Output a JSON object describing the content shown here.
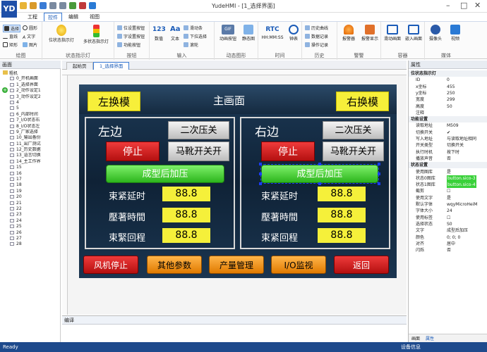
{
  "app": {
    "logo": "YD",
    "title": "YudeHMI - [1_选择界面]"
  },
  "menu": [
    "工程",
    "控件",
    "编辑",
    "视图"
  ],
  "ribbon": {
    "draw": {
      "caption": "绘图",
      "items": [
        "选择",
        "圆形",
        "直线",
        "文字",
        "矩形",
        "图片"
      ]
    },
    "indicator": {
      "caption": "状态指示灯",
      "items": [
        "位状态指示灯",
        "多状态指示灯"
      ]
    },
    "button": {
      "caption": "按钮",
      "items": [
        "位设置按钮",
        "字设置按钮",
        "功能按钮"
      ]
    },
    "input": {
      "caption": "输入",
      "items": [
        "数值",
        "文本",
        "滑动条",
        "下拉选择",
        "滚轮"
      ]
    },
    "dynamic": {
      "caption": "动态图形",
      "items": [
        "动画按钮",
        "静态图"
      ]
    },
    "time": {
      "caption": "时间",
      "items": [
        "HH:MM:SS",
        "钟表"
      ]
    },
    "history": {
      "caption": "历史",
      "items": [
        "历史曲线",
        "数据记录",
        "操作记录"
      ]
    },
    "alarm": {
      "caption": "警警",
      "items": [
        "报警器",
        "报警显示"
      ]
    },
    "container": {
      "caption": "容器",
      "items": [
        "滑动画面",
        "嵌入画面"
      ]
    },
    "media": {
      "caption": "媒体",
      "items": [
        "摄像头",
        "视频"
      ]
    }
  },
  "left_panel": {
    "title": "画面",
    "root": "粗机",
    "items": [
      "0_开机画面",
      "1_选择界面",
      "2_动作设定1",
      "3_动作设定2",
      "4",
      "5",
      "6_内部时间",
      "7_I/O状态右",
      "8_I/O状态左",
      "9_厂家选择",
      "10_输出备份",
      "11_出厂测试",
      "12_历史数据",
      "13_语言切换",
      "14_主工作界",
      "15",
      "16",
      "17",
      "18",
      "19",
      "20",
      "21",
      "22",
      "23",
      "24",
      "25",
      "26",
      "27",
      "28"
    ]
  },
  "tabs": [
    "起始页",
    "1_选择界面"
  ],
  "hmi": {
    "left_switch": "左换模",
    "title": "主画面",
    "right_switch": "右换模",
    "left": {
      "side": "左边",
      "second_press": "二次压关",
      "stop": "停止",
      "boot_switch": "马靴开关开",
      "form_press": "成型后加压",
      "rows": [
        {
          "label": "束紧延时",
          "value": "88.8"
        },
        {
          "label": "壓著時間",
          "value": "88.8"
        },
        {
          "label": "束緊回程",
          "value": "88.8"
        }
      ]
    },
    "right": {
      "side": "右边",
      "second_press": "二次压关",
      "stop": "停止",
      "boot_switch": "马靴开关开",
      "form_press": "成型后加压",
      "rows": [
        {
          "label": "束紧延时",
          "value": "88.8"
        },
        {
          "label": "壓著時間",
          "value": "88.8"
        },
        {
          "label": "束紧回程",
          "value": "88.8"
        }
      ]
    },
    "bottom": [
      "风机停止",
      "其他参数",
      "产量管理",
      "I/O监视",
      "返回"
    ]
  },
  "compile_title": "编译",
  "properties": {
    "title": "属性",
    "sections": [
      {
        "head": "位状态指示灯",
        "rows": [
          [
            "ID",
            "0"
          ],
          [
            "x坐标",
            "455"
          ],
          [
            "y坐标",
            "250"
          ],
          [
            "宽度",
            "299"
          ],
          [
            "高度",
            "50"
          ],
          [
            "注释",
            ""
          ]
        ]
      },
      {
        "head": "功能设置",
        "rows": [
          [
            "读取地址",
            "M509"
          ],
          [
            "切换开关",
            "✔"
          ],
          [
            "写入地址",
            "与读取地址相同"
          ],
          [
            "开关类型",
            "切换开关"
          ],
          [
            "执行时机",
            "按下时"
          ],
          [
            "播放声音",
            "否"
          ]
        ]
      },
      {
        "head": "状态设置",
        "rows": [
          [
            "使用图库",
            "是"
          ],
          [
            "状态0图库",
            "button.sico-3"
          ],
          [
            "状态1图库",
            "button.sico-4"
          ],
          [
            "截剪",
            "☐"
          ],
          [
            "使用文字",
            "是"
          ],
          [
            "默认字体",
            "wqyMicroHeiM"
          ],
          [
            "字体大小",
            "24"
          ],
          [
            "使用标签",
            "☐"
          ],
          [
            "选择状态",
            "S0"
          ],
          [
            "文字",
            "成型后加压"
          ],
          [
            "颜色",
            "0; 0; 0"
          ],
          [
            "对齐",
            "居中"
          ],
          [
            "闪烁",
            "否"
          ]
        ]
      }
    ],
    "tabs": [
      "画面",
      "属性"
    ]
  },
  "status": {
    "left": "Ready",
    "right": "设备信息"
  },
  "colors": {
    "ribbon_accent": "#3a7bd5",
    "hmi_bg": "#0f2236",
    "yellow": "#f7ef3a",
    "status_bar": "#1e4a8c"
  }
}
